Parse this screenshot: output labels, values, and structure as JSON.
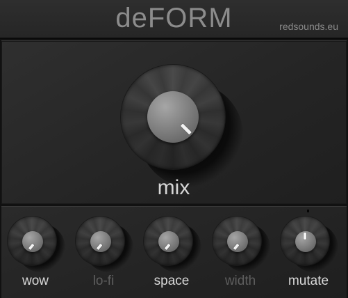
{
  "header": {
    "title": "deFORM",
    "brand": "redsounds.eu"
  },
  "main_knob": {
    "label": "mix"
  },
  "knobs": [
    {
      "label": "wow",
      "active": true
    },
    {
      "label": "lo-fi",
      "active": false
    },
    {
      "label": "space",
      "active": true
    },
    {
      "label": "width",
      "active": false
    },
    {
      "label": "mutate",
      "active": true
    }
  ],
  "colors": {
    "background": "#111111",
    "panel": "#2a2a2a",
    "label_active": "#d8d8d8",
    "label_inactive": "#5e5e5e",
    "pointer": "#f2f2f2"
  }
}
